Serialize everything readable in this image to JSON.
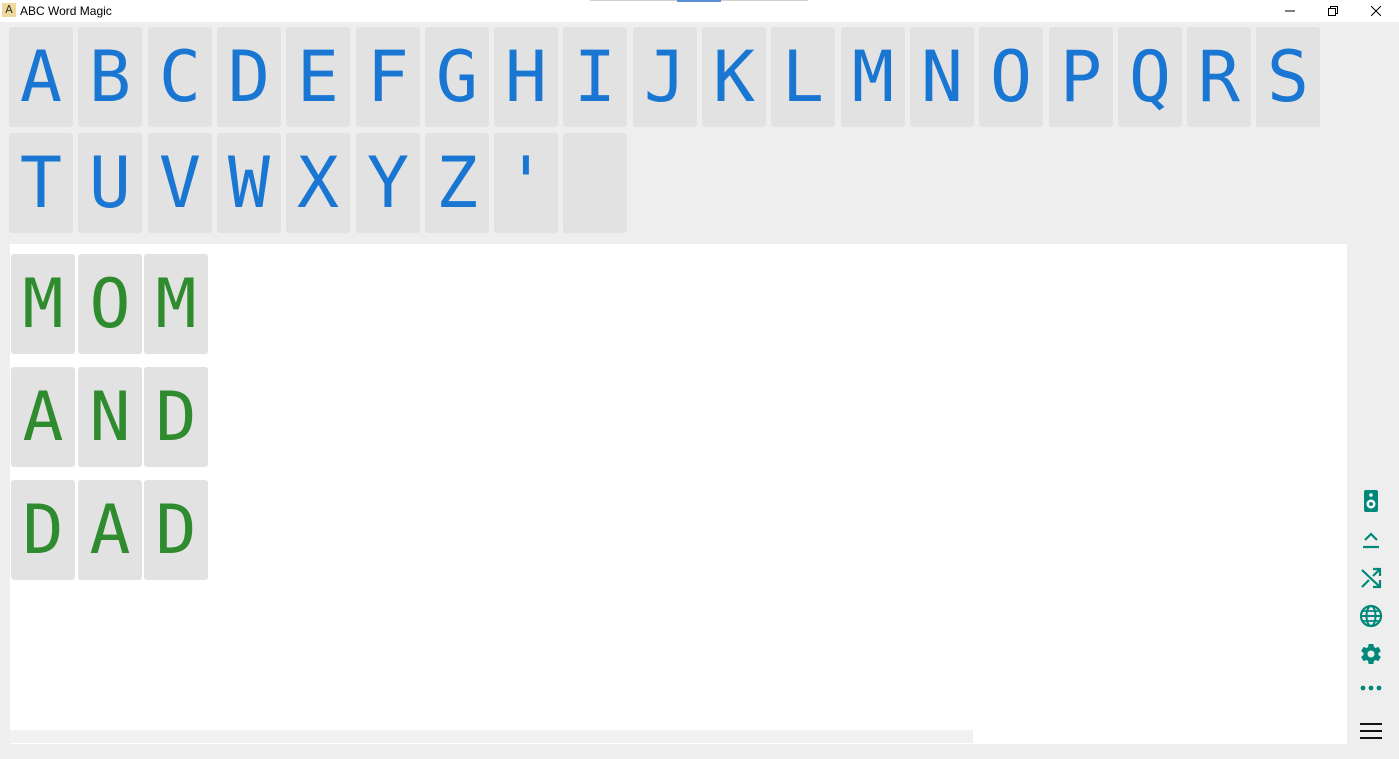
{
  "window": {
    "title": "ABC Word Magic",
    "icon_letter": "A"
  },
  "alphabet_keys": [
    "A",
    "B",
    "C",
    "D",
    "E",
    "F",
    "G",
    "H",
    "I",
    "J",
    "K",
    "L",
    "M",
    "N",
    "O",
    "P",
    "Q",
    "R",
    "S",
    "T",
    "U",
    "V",
    "W",
    "X",
    "Y",
    "Z",
    "'",
    ""
  ],
  "words": [
    {
      "letters": [
        "M",
        "O",
        "M"
      ]
    },
    {
      "letters": [
        "A",
        "N",
        "D"
      ]
    },
    {
      "letters": [
        "D",
        "A",
        "D"
      ]
    }
  ],
  "colors": {
    "key_letter": "#1976d2",
    "word_letter": "#2e8b2e",
    "side_icon": "#00897b"
  },
  "side_toolbar": [
    {
      "icon": "speaker-icon"
    },
    {
      "icon": "collapse-up-icon"
    },
    {
      "icon": "shuffle-icon"
    },
    {
      "icon": "globe-icon"
    },
    {
      "icon": "gear-icon"
    },
    {
      "icon": "more-icon"
    },
    {
      "icon": "hamburger-menu-icon"
    }
  ]
}
